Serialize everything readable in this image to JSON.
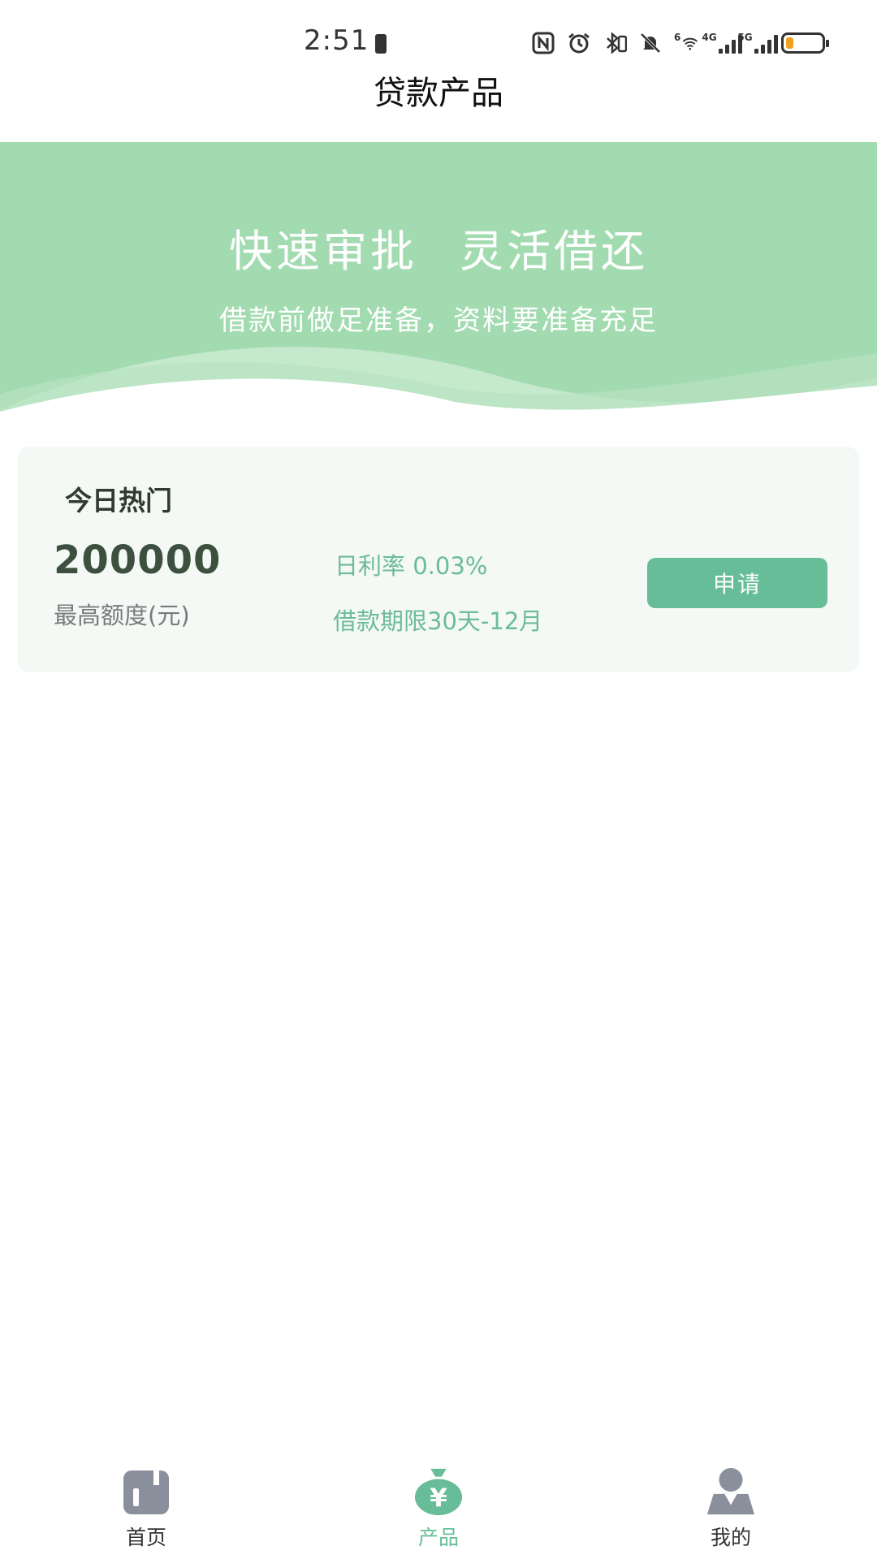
{
  "status_bar": {
    "time": "2:51",
    "network_wifi_tag": "6",
    "network_4g_tag": "4G",
    "network_5g_tag": "5G",
    "battery_color": "#f0a020"
  },
  "header": {
    "title": "贷款产品"
  },
  "banner": {
    "headline_part1": "快速审批",
    "headline_part2": "灵活借还",
    "subtitle": "借款前做足准备，资料要准备充足",
    "color": "#a3dbb1"
  },
  "hot_card": {
    "title": "今日热门",
    "amount": "200000",
    "amount_label": "最高额度(元)",
    "rate": "日利率 0.03%",
    "term": "借款期限30天-12月",
    "apply_label": "申请"
  },
  "bottom_nav": {
    "items": [
      {
        "label": "首页",
        "icon": "home-icon",
        "active": false
      },
      {
        "label": "产品",
        "icon": "money-bag-icon",
        "active": true
      },
      {
        "label": "我的",
        "icon": "user-icon",
        "active": false
      }
    ],
    "active_color": "#67bd98",
    "inactive_icon_color": "#8a8f9c"
  }
}
